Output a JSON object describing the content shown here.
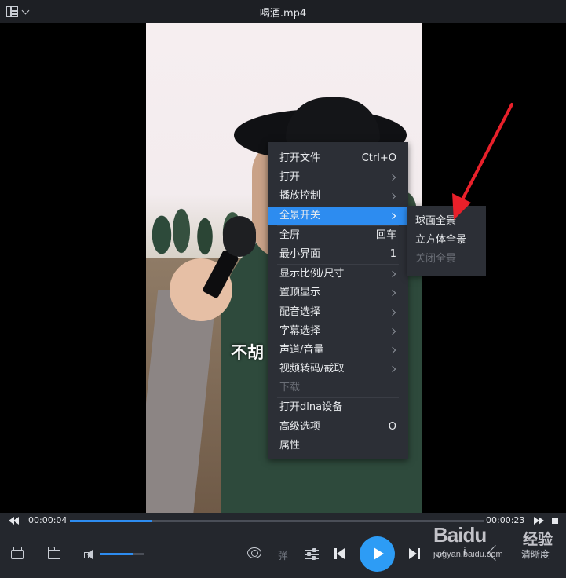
{
  "window": {
    "title": "喝酒.mp4"
  },
  "video": {
    "subtitle": "不胡"
  },
  "context_menu": {
    "items": [
      {
        "label": "打开文件",
        "shortcut": "Ctrl+O",
        "submenu": false,
        "disabled": false
      },
      {
        "label": "打开",
        "shortcut": "",
        "submenu": true,
        "disabled": false
      },
      {
        "label": "播放控制",
        "shortcut": "",
        "submenu": true,
        "disabled": false
      },
      {
        "label": "全景开关",
        "shortcut": "",
        "submenu": true,
        "disabled": false,
        "active": true
      },
      {
        "label": "全屏",
        "shortcut": "回车",
        "submenu": false,
        "disabled": false
      },
      {
        "label": "最小界面",
        "shortcut": "1",
        "submenu": false,
        "disabled": false
      },
      {
        "label": "显示比例/尺寸",
        "shortcut": "",
        "submenu": true,
        "disabled": false
      },
      {
        "label": "置顶显示",
        "shortcut": "",
        "submenu": true,
        "disabled": false
      },
      {
        "label": "配音选择",
        "shortcut": "",
        "submenu": true,
        "disabled": false
      },
      {
        "label": "字幕选择",
        "shortcut": "",
        "submenu": true,
        "disabled": false
      },
      {
        "label": "声道/音量",
        "shortcut": "",
        "submenu": true,
        "disabled": false
      },
      {
        "label": "视频转码/截取",
        "shortcut": "",
        "submenu": true,
        "disabled": false
      },
      {
        "label": "下载",
        "shortcut": "",
        "submenu": false,
        "disabled": true
      },
      {
        "label": "打开dlna设备",
        "shortcut": "",
        "submenu": false,
        "disabled": false
      },
      {
        "label": "高级选项",
        "shortcut": "O",
        "submenu": false,
        "disabled": false
      },
      {
        "label": "属性",
        "shortcut": "",
        "submenu": false,
        "disabled": false
      }
    ]
  },
  "submenu": {
    "items": [
      {
        "label": "球面全景",
        "disabled": false
      },
      {
        "label": "立方体全景",
        "disabled": false
      },
      {
        "label": "关闭全景",
        "disabled": true
      }
    ]
  },
  "progress": {
    "current_time": "00:00:04",
    "total_time": "00:00:23",
    "fraction": 0.2
  },
  "controls": {
    "danmu_label": "弹",
    "quality_label": "清晰度",
    "volume_fraction": 0.75
  },
  "watermark": {
    "brand": "Baidu",
    "jingyan": "经验",
    "url": "jingyan.baidu.com"
  },
  "colors": {
    "accent": "#2d8cf0",
    "menu_bg": "#2c2f36",
    "bar_bg": "#24272d",
    "arrow_red": "#e8202a"
  },
  "icons": [
    "playlist-menu-icon",
    "chevron-down-icon",
    "toolbox-icon",
    "folder-icon",
    "volume-icon",
    "vr-eye-icon",
    "equalizer-icon",
    "previous-icon",
    "play-icon",
    "next-icon",
    "check-icon",
    "info-icon",
    "expand-icon",
    "rewind-icon",
    "fast-forward-icon",
    "stop-icon"
  ]
}
